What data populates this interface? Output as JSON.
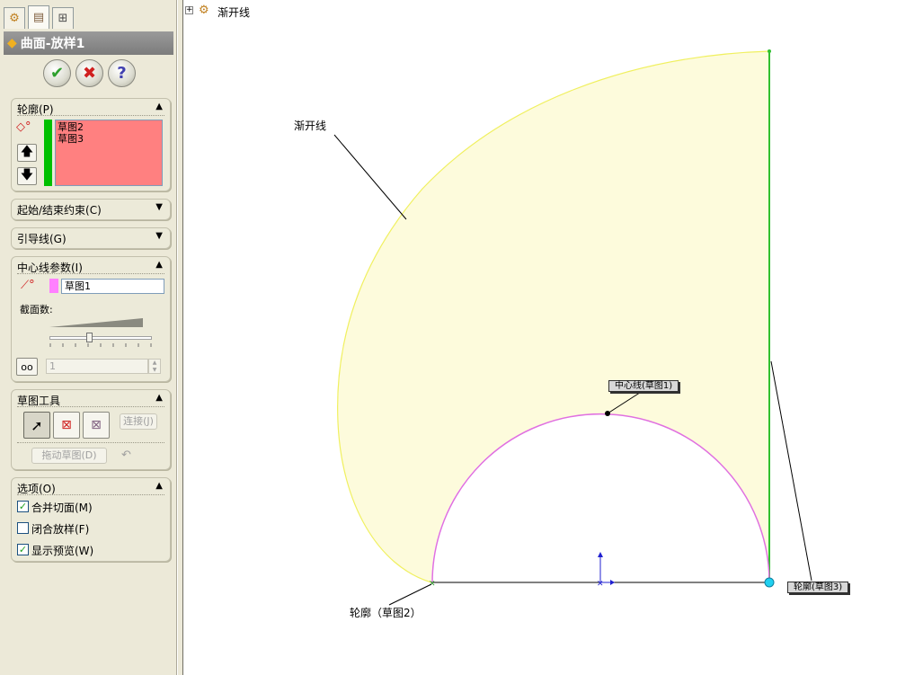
{
  "property_manager": {
    "title": "曲面-放样1",
    "tabs": [
      "feature-manager-icon",
      "property-manager-icon",
      "configuration-manager-icon"
    ],
    "actions": {
      "ok": "✔",
      "cancel": "✖",
      "help": "?"
    }
  },
  "groups": {
    "profiles": {
      "title": "轮廓(P)",
      "items": [
        "草图2",
        "草图3"
      ]
    },
    "start_end": {
      "title": "起始/结束约束(C)"
    },
    "guide": {
      "title": "引导线(G)"
    },
    "centerline": {
      "title": "中心线参数(I)",
      "value": "草图1",
      "sections_label": "截面数:",
      "sections_value": "1"
    },
    "sketch_tools": {
      "title": "草图工具",
      "connect_label": "连接(J)",
      "drag_label": "拖动草图(D)"
    },
    "options": {
      "title": "选项(O)",
      "items": [
        {
          "label": "合并切面(M)",
          "checked": true
        },
        {
          "label": "闭合放样(F)",
          "checked": false
        },
        {
          "label": "显示预览(W)",
          "checked": true
        }
      ]
    }
  },
  "tree": {
    "expand": "+",
    "label": "渐开线"
  },
  "viewport": {
    "annotations": {
      "involute_label": "渐开线",
      "centerline_callout": "中心线(草图1)",
      "profile_callout": "轮廓(草图3)",
      "profile2_label": "轮廓（草图2）"
    },
    "colors": {
      "preview_fill": "#fdfbdc",
      "preview_edge": "#f0f060",
      "centerline": "#e070e0",
      "profile3": "#30c030",
      "profile2": "#000000"
    }
  }
}
